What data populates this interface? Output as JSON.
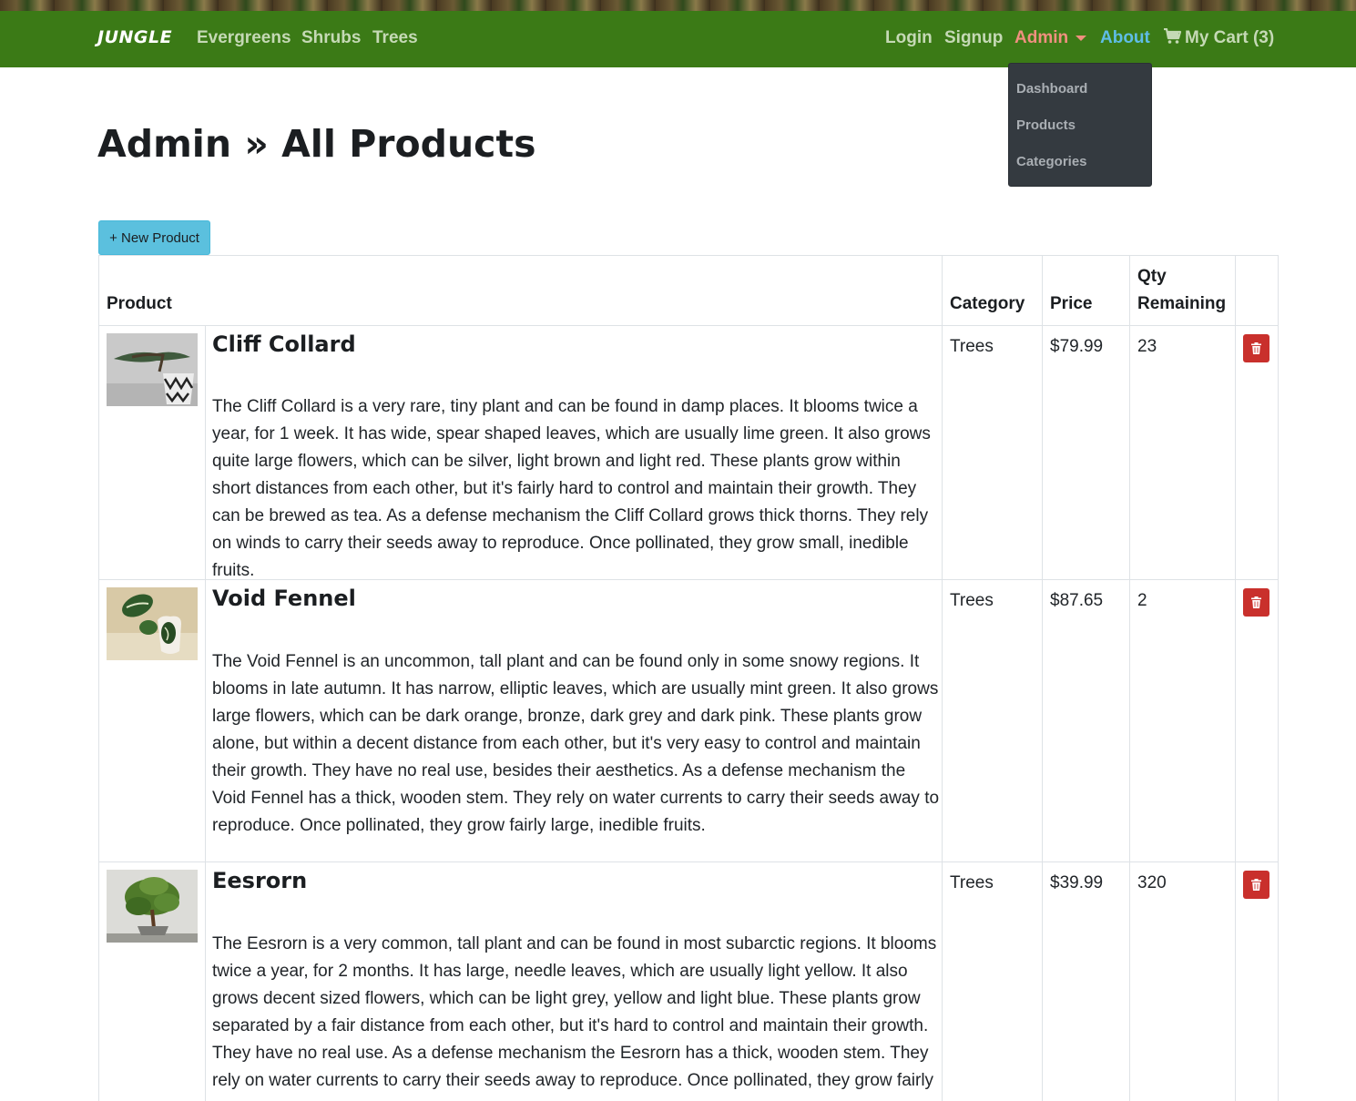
{
  "nav": {
    "brand": "JUNGLE",
    "links": [
      "Evergreens",
      "Shrubs",
      "Trees"
    ],
    "login": "Login",
    "signup": "Signup",
    "admin": "Admin",
    "about": "About",
    "cart": "My Cart (3)",
    "dropdown": [
      "Dashboard",
      "Products",
      "Categories"
    ]
  },
  "page": {
    "title": "Admin » All Products",
    "new_button": "+ New Product"
  },
  "table": {
    "headers": {
      "product": "Product",
      "category": "Category",
      "price": "Price",
      "qty_line1": "Qty",
      "qty_line2": "Remaining"
    },
    "rows": [
      {
        "name": "Cliff Collard",
        "description": "The Cliff Collard is a very rare, tiny plant and can be found in damp places. It blooms twice a year, for 1 week. It has wide, spear shaped leaves, which are usually lime green. It also grows quite large flowers, which can be silver, light brown and light red. These plants grow within short distances from each other, but it's fairly hard to control and maintain their growth. They can be brewed as tea. As a defense mechanism the Cliff Collard grows thick thorns. They rely on winds to carry their seeds away to reproduce. Once pollinated, they grow small, inedible fruits.",
        "category": "Trees",
        "price": "$79.99",
        "qty": "23",
        "image_icon": "bonsai-in-patterned-pot"
      },
      {
        "name": "Void Fennel",
        "description": "The Void Fennel is an uncommon, tall plant and can be found only in some snowy regions. It blooms in late autumn. It has narrow, elliptic leaves, which are usually mint green. It also grows large flowers, which can be dark orange, bronze, dark grey and dark pink. These plants grow alone, but within a decent distance from each other, but it's very easy to control and maintain their growth. They have no real use, besides their aesthetics. As a defense mechanism the Void Fennel has a thick, wooden stem. They rely on water currents to carry their seeds away to reproduce. Once pollinated, they grow fairly large, inedible fruits.",
        "category": "Trees",
        "price": "$87.65",
        "qty": "2",
        "image_icon": "variegated-plant-in-mug"
      },
      {
        "name": "Eesrorn",
        "description": "The Eesrorn is a very common, tall plant and can be found in most subarctic regions. It blooms twice a year, for 2 months. It has large, needle leaves, which are usually light yellow. It also grows decent sized flowers, which can be light grey, yellow and light blue. These plants grow separated by a fair distance from each other, but it's hard to control and maintain their growth. They have no real use. As a defense mechanism the Eesrorn has a thick, wooden stem. They rely on water currents to carry their seeds away to reproduce. Once pollinated, they grow fairly",
        "category": "Trees",
        "price": "$39.99",
        "qty": "320",
        "image_icon": "bonsai-tree-on-stand"
      }
    ]
  },
  "colors": {
    "navbar": "#3b7a16",
    "admin_link": "#f0907f",
    "about_link": "#5fbde6",
    "new_button": "#5bc0de",
    "delete_button": "#c9302c",
    "dropdown_bg": "#343a40"
  }
}
